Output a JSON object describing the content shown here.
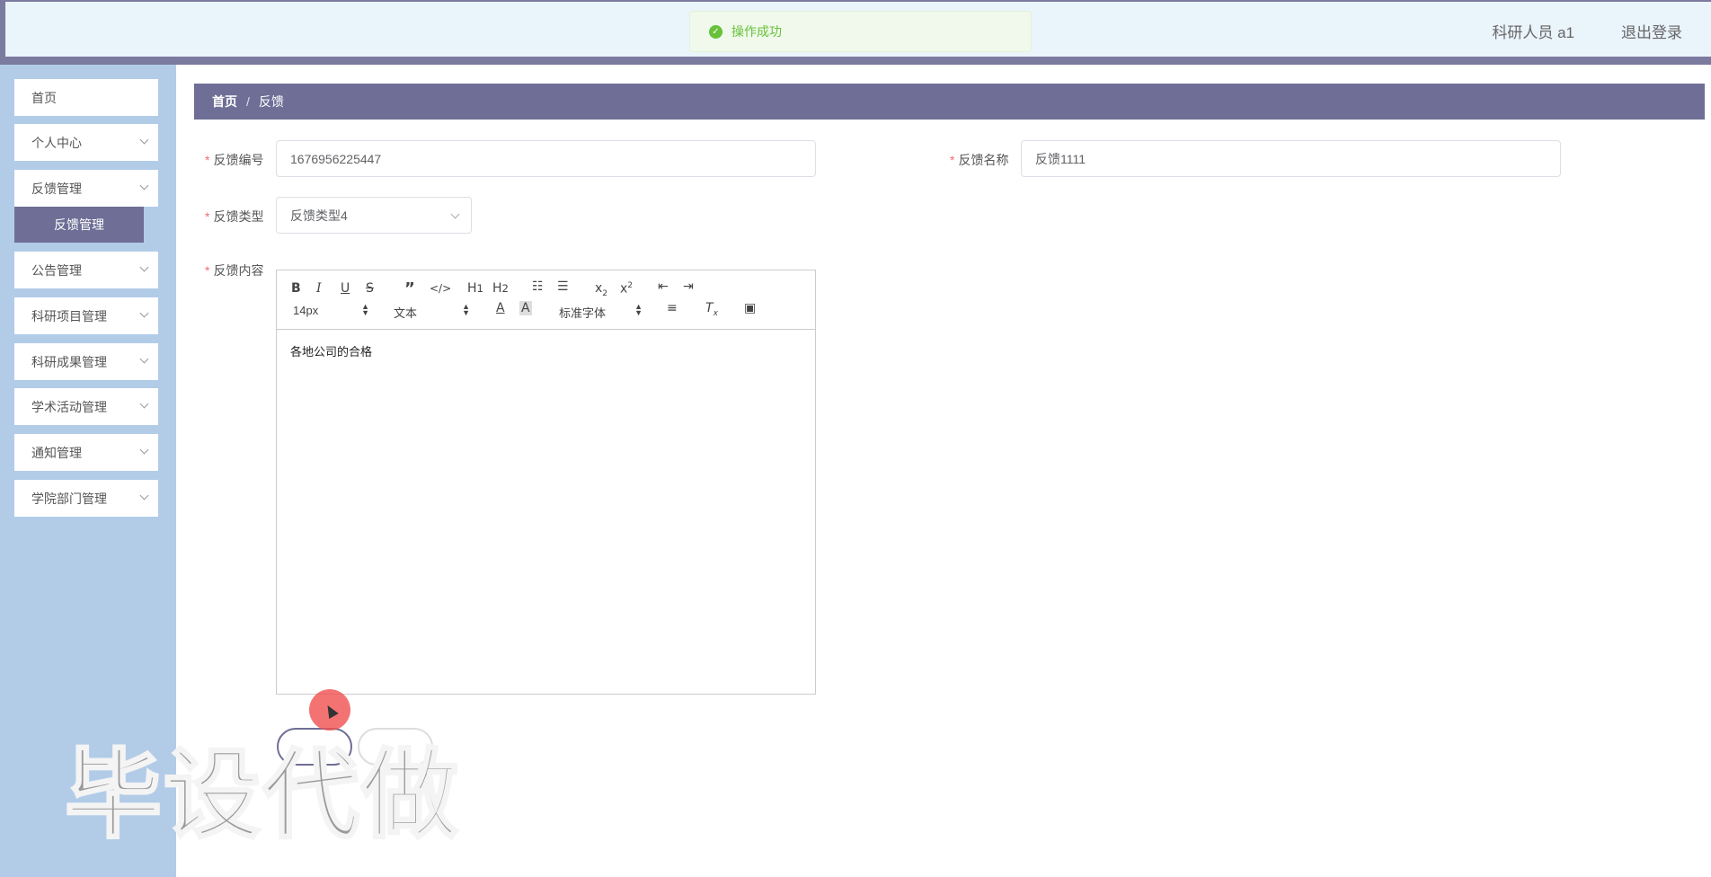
{
  "header": {
    "user": "科研人员 a1",
    "logout": "退出登录",
    "bg_color": "#eaf4fb"
  },
  "toast": {
    "icon": "check-circle-icon",
    "message": "操作成功"
  },
  "sidebar": {
    "items": [
      {
        "label": "首页",
        "expandable": false
      },
      {
        "label": "个人中心",
        "expandable": true
      },
      {
        "label": "反馈管理",
        "expandable": true
      },
      {
        "label": "公告管理",
        "expandable": true
      },
      {
        "label": "科研项目管理",
        "expandable": true
      },
      {
        "label": "科研成果管理",
        "expandable": true
      },
      {
        "label": "学术活动管理",
        "expandable": true
      },
      {
        "label": "通知管理",
        "expandable": true
      },
      {
        "label": "学院部门管理",
        "expandable": true
      }
    ],
    "active_submenu": "反馈管理",
    "accent_color": "#6e6e96"
  },
  "breadcrumb": {
    "home": "首页",
    "separator": "/",
    "current": "反馈"
  },
  "form": {
    "feedback_no_label": "反馈编号",
    "feedback_no_value": "1676956225447",
    "feedback_name_label": "反馈名称",
    "feedback_name_value": "反馈1111",
    "feedback_type_label": "反馈类型",
    "feedback_type_value": "反馈类型4",
    "feedback_content_label": "反馈内容",
    "required_mark": "*"
  },
  "editor": {
    "font_size": "14px",
    "header_select": "文本",
    "font_family": "标准字体",
    "content": "各地公司的合格"
  },
  "watermark": "毕设代做"
}
